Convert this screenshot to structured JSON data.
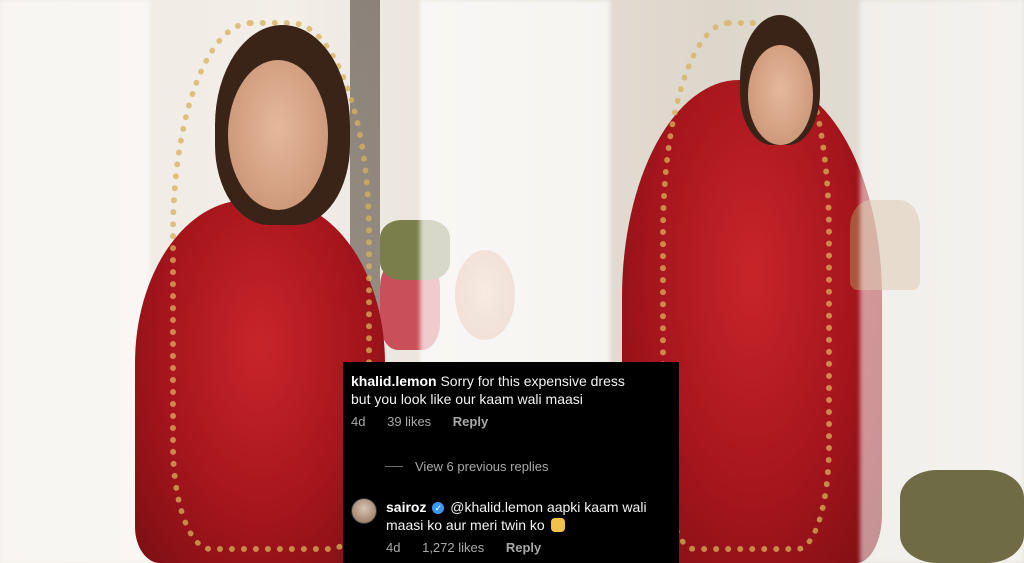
{
  "comment": {
    "username": "khalid.lemon",
    "text_line1": "Sorry for this expensive dress",
    "text_line2": "but you look like our kaam wali maasi",
    "age": "4d",
    "likes": "39 likes",
    "reply_label": "Reply"
  },
  "view_replies_label": "View 6 previous replies",
  "reply": {
    "username": "sairoz",
    "text_line1": "@khalid.lemon aapki kaam wali",
    "text_line2": "maasi ko aur meri twin ko",
    "emoji": "woman-facepalming-emoji",
    "age": "4d",
    "likes": "1,272 likes",
    "reply_label": "Reply"
  },
  "colors": {
    "card_bg": "#000000",
    "meta_text": "#a8a8a8",
    "verified_blue": "#3897f0",
    "dress_red": "#b3161d"
  }
}
